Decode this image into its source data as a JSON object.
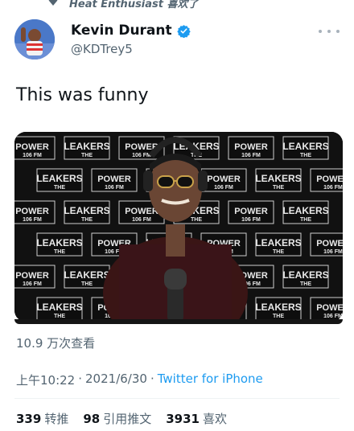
{
  "context": {
    "text": "Heat Enthusiast 喜欢了"
  },
  "author": {
    "display_name": "Kevin Durant",
    "handle": "@KDTrey5",
    "verified": true
  },
  "tweet": {
    "text": "This was funny"
  },
  "media": {
    "banner_words": [
      "POWER",
      "106 FM",
      "LEAKERS",
      "THE"
    ]
  },
  "views": "10.9 万次查看",
  "meta": {
    "time": "上午10:22",
    "date": "2021/6/30",
    "separator": "·",
    "source": "Twitter for iPhone"
  },
  "stats": [
    {
      "num": "339",
      "label": "转推"
    },
    {
      "num": "98",
      "label": "引用推文"
    },
    {
      "num": "3931",
      "label": "喜欢"
    }
  ],
  "colors": {
    "link": "#1d9bf0",
    "muted": "#536471",
    "verified": "#1d9bf0"
  }
}
